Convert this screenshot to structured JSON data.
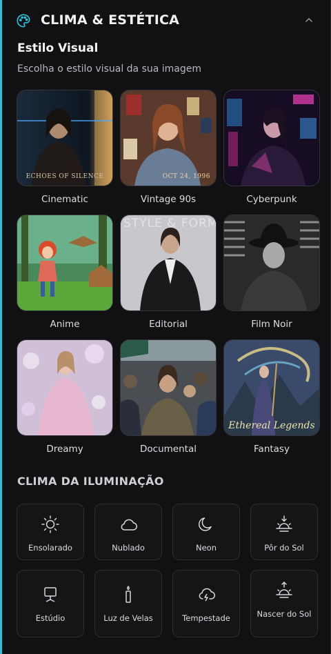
{
  "header": {
    "title": "CLIMA & ESTÉTICA",
    "icon": "palette-icon",
    "collapse_icon": "chevron-up-icon",
    "accent_color": "#29c5d6"
  },
  "visual_style": {
    "title": "Estilo Visual",
    "subtitle": "Escolha o estilo visual da sua imagem",
    "styles": [
      {
        "label": "Cinematic",
        "caption": "ECHOES OF SILENCE"
      },
      {
        "label": "Vintage 90s",
        "caption": "OCT 24, 1996"
      },
      {
        "label": "Cyberpunk"
      },
      {
        "label": "Anime"
      },
      {
        "label": "Editorial",
        "caption": "STYLE & FORM"
      },
      {
        "label": "Film Noir"
      },
      {
        "label": "Dreamy"
      },
      {
        "label": "Documental"
      },
      {
        "label": "Fantasy",
        "caption": "Ethereal Legends"
      }
    ]
  },
  "lighting": {
    "title": "CLIMA DA ILUMINAÇÃO",
    "options": [
      {
        "label": "Ensolarado",
        "icon": "sun-icon"
      },
      {
        "label": "Nublado",
        "icon": "cloud-icon"
      },
      {
        "label": "Neon",
        "icon": "moon-icon"
      },
      {
        "label": "Pôr do Sol",
        "icon": "sunset-icon"
      },
      {
        "label": "Estúdio",
        "icon": "monitor-icon"
      },
      {
        "label": "Luz de Velas",
        "icon": "candle-icon"
      },
      {
        "label": "Tempestade",
        "icon": "storm-cloud-icon"
      },
      {
        "label": "Nascer do Sol",
        "icon": "sunrise-icon"
      }
    ]
  }
}
